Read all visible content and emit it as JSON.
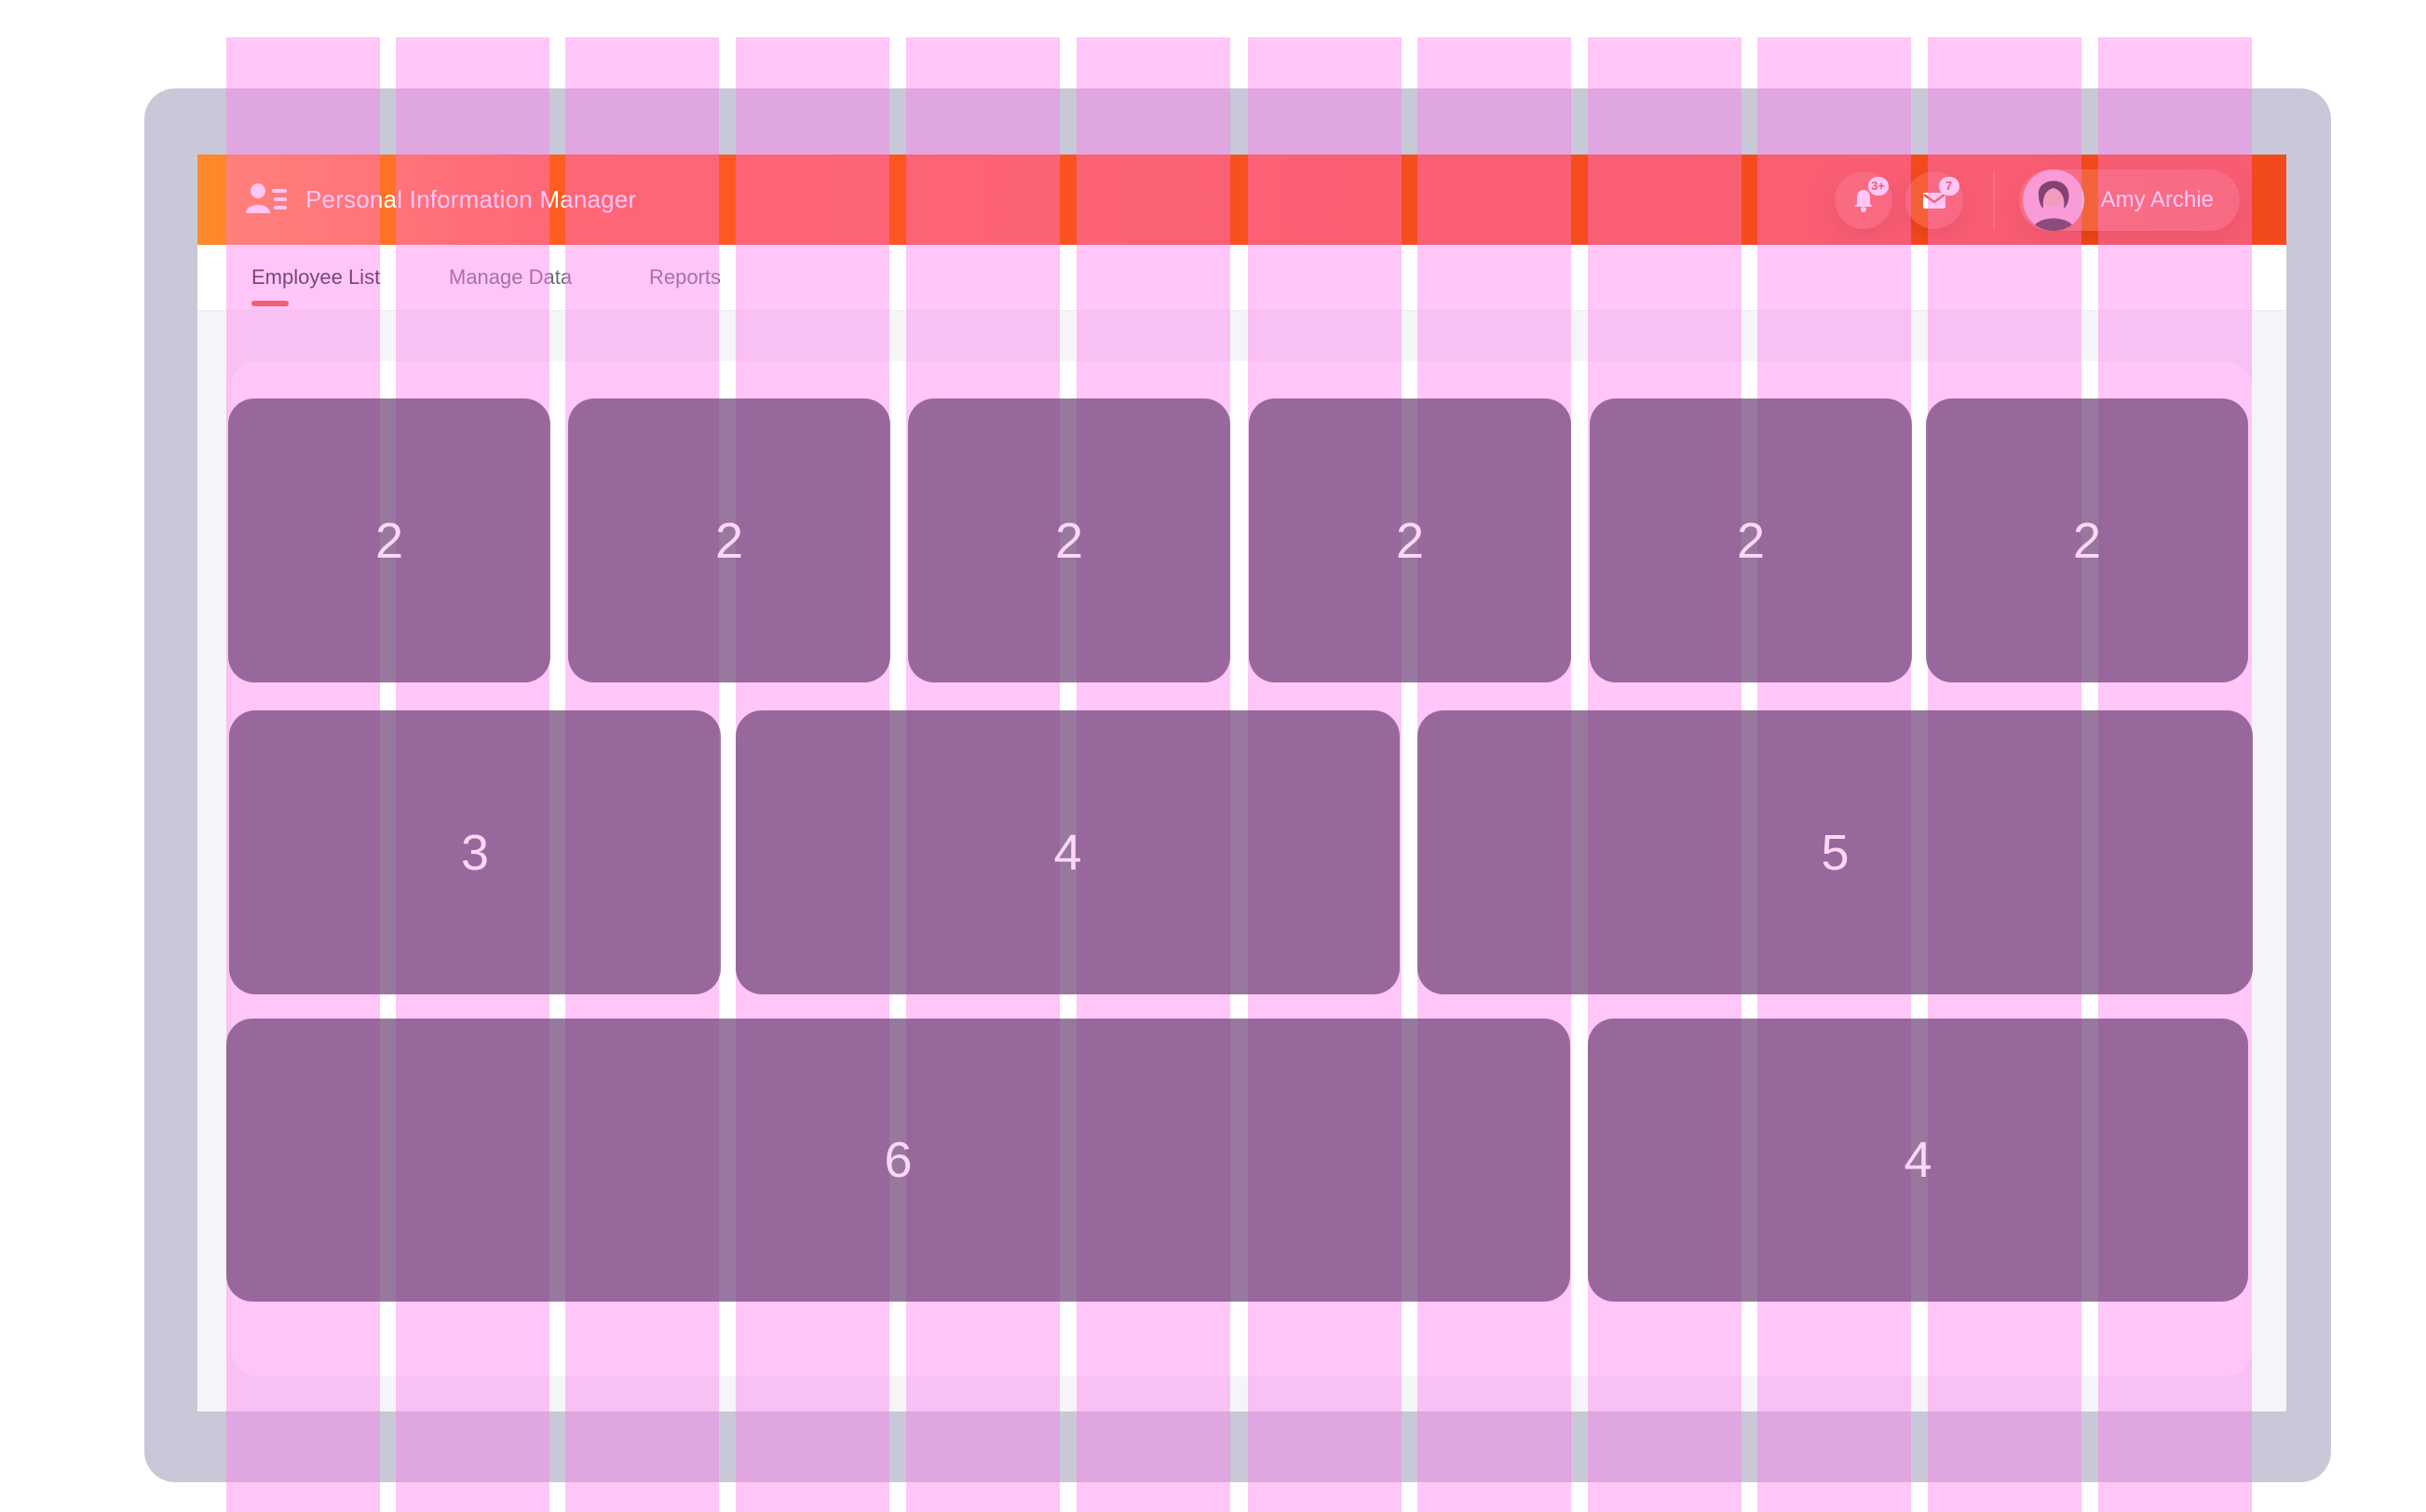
{
  "app": {
    "title": "Personal Information Manager",
    "accent_color": "#f24a1c",
    "brand_icon": "users-list-icon"
  },
  "header": {
    "notifications": {
      "icon": "bell-icon",
      "count": "3+"
    },
    "messages": {
      "icon": "mail-icon",
      "count": "7"
    },
    "user": {
      "name": "Amy Archie",
      "avatar": "avatar"
    }
  },
  "tabs": [
    {
      "label": "Employee List",
      "active": true
    },
    {
      "label": "Manage Data",
      "active": false
    },
    {
      "label": "Reports",
      "active": false
    }
  ],
  "grid_overlay": {
    "column_color": "#ff78eb",
    "cell_color": "#70447a",
    "row1_cells": [
      "2",
      "2",
      "2",
      "2",
      "2",
      "2"
    ],
    "row2_cells": [
      "3",
      "4",
      "5"
    ],
    "row3_cells": [
      "6",
      "4"
    ]
  }
}
